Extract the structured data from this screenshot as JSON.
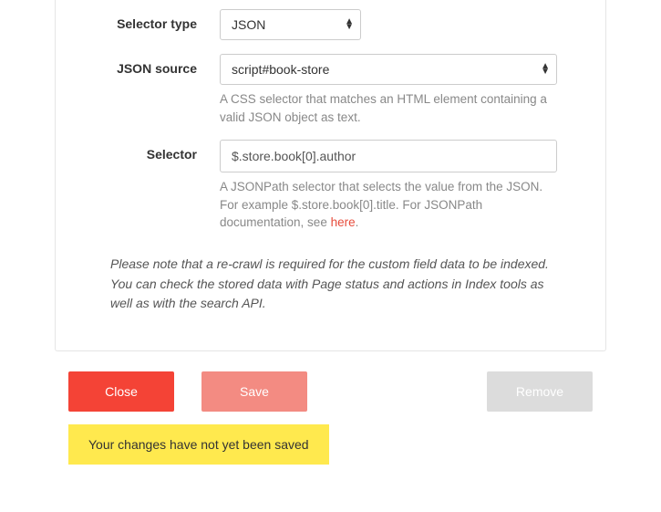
{
  "form": {
    "selector_type": {
      "label": "Selector type",
      "value": "JSON"
    },
    "json_source": {
      "label": "JSON source",
      "value": "script#book-store",
      "help": "A CSS selector that matches an HTML element containing a valid JSON object as text."
    },
    "selector": {
      "label": "Selector",
      "value": "$.store.book[0].author",
      "help_pre": "A JSONPath selector that selects the value from the JSON. For example $.store.book[0].title. For JSONPath documentation, see ",
      "help_link": "here",
      "help_post": "."
    }
  },
  "note": "Please note that a re-crawl is required for the custom field data to be indexed. You can check the stored data with Page status and actions in Index tools as well as with the search API.",
  "buttons": {
    "close": "Close",
    "save": "Save",
    "remove": "Remove"
  },
  "alert": "Your changes have not yet been saved"
}
